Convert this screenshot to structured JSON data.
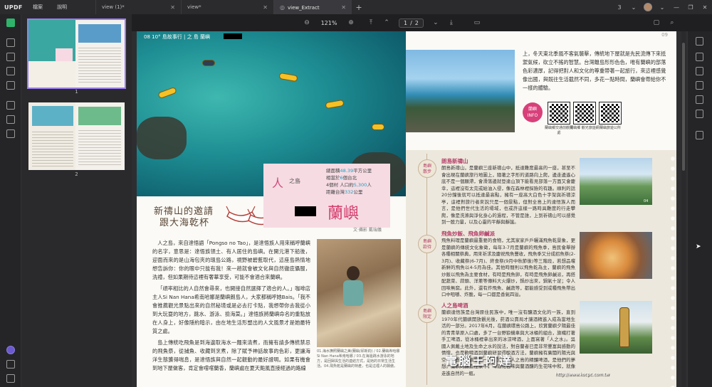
{
  "app": {
    "logo": "UPDF",
    "menu": [
      "檔案",
      "說明"
    ]
  },
  "tabs": [
    {
      "label": "view (1)*",
      "active": false
    },
    {
      "label": "view*",
      "active": false
    },
    {
      "label": "view_Extract",
      "active": true
    }
  ],
  "window": {
    "page_counter": "3"
  },
  "toolbar": {
    "zoom": "121%",
    "current_page": "1",
    "total_pages": "2"
  },
  "thumbnails": [
    {
      "number": "1",
      "selected": true
    },
    {
      "number": "2",
      "selected": false
    }
  ],
  "left_page": {
    "header": "08  10° 島故事行 | 之 島   蘭嶼",
    "headline_line1": "新禱山的邀請",
    "headline_line2": "跟大海乾杯",
    "ren": "人",
    "zhi_dao": "之島",
    "stats": [
      {
        "pre": "總面積",
        "num": "48.39",
        "post": "平方公里"
      },
      {
        "pre": "相當於",
        "num": "6",
        "post": "個台北"
      },
      {
        "pre": "4個村 人口約",
        "num": "5,300",
        "post": "人"
      },
      {
        "pre": "距離台灣",
        "num": "332",
        "post": "公里"
      }
    ],
    "island_title": "蘭嶼",
    "author": "文‧攝影 戴瑞儀",
    "body": [
      "人之島，來自達悟語「Pongso no Tao」，是達悟族人用來稱呼蘭嶼的名字，意思是：達悟族領土、有人居住的島嶼。在開元港下船後，迎面而來的是山海包夾的環島公路，視野被碧藍取代，這座島熱情地想告訴你：你的眼中只能有我！來一趟就會被文化與自然徹底懾服，洗禮，但如果期待這裡有奢華享受，可能不會適合來蘭嶼。",
      "「頑率相比的人自然會尋來，也開接自然選擇了適合的人。」咖啡店主人Si Nan Hana希南哈娜是蘭嶼朗島人，大家都稱呼她Bais。「我不會推薦觀光景點出來的自然秘境或是必去打卡點，我想帶你去我從小到大玩耍的地方，跳水、游泳、撿海菜。」達悟族將蘭嶼命名的重點放在人身上，好像隱約暗示，由在地生活形塑出的人文風景才是她最特質之處。",
      "島上傳統吃飛魚是到海邊取海水一麵來清煮，而擁有請多傳統禁忌的飛魚祭，從捕魚、收藏到烹煮，除了賦予神話故事的色彩，更讓海洋生態獲得喘息，是達悟族與自然一起觀動的最好證明。如果有機會到地下屋做客，肯定會嚐嚐蘭香，蘭嶼處在夏天颱風直接經過的路線"
    ],
    "caption": "01.海水撫照蘭嶼之美(蘭嶼/邱新鈞) / 02.蘭嶼希哈娜Si Nan Hana希南哈娜 / 03.在海邊跳水游泳的地方，是回歸與生活的連結方式，是她的日常生活生活。04.飛魚乾是蘭嶼的特產，也是這裡人的驕傲。"
  },
  "right_page": {
    "page_number": "09",
    "intro": "上，冬天東北季風不客氣襲擊，傳統地下屋就是先民流傳下來抵禦氣候，砍立不搖的智慧。台灣離島形形色色，唯有蘭嶼的部落色彩濃厚，記得把對人和文化的尊重帶著一起旅行，來這裡感覺像出國，與既往生活截然不同，多花一點時間，蘭嶼會帶給你不一樣的體驗。",
    "info_badge_line1": "蘭嶼",
    "info_badge_line2": "INFO",
    "qr_labels": [
      "蘭嶼鄉交通前觀光處",
      "蘭嶼鄉 觀光旅遊網",
      "蘭嶼旅遊公所"
    ],
    "sections": [
      {
        "badge_line1": "島嶼",
        "badge_line2": "散步",
        "title": "朗島新禱山",
        "text": "朗島新禱山，是蘭嶼三座新禱山中，抵達難度最高的一座，甚至不會出現在蘭嶼旅行地圖上，隨著之字形的道路向上爬，邊走邊遙心底不是一個願滯，會滑落邊就登達山頂下能看見部落一方面又會慶幸，這裡沒有太完或給油入侵，像在森林裡探險的有趣。順利的話20分鐘後就可以抵達最高點，擁有一座高大白色十字架與祈禱涼亭，這裡對旅行者來說只是一個景點，但對全島上的達悟族人而言，是他們世代生活的場域，也或許這樣一路時具難度的行走攀爬，像是洗滌與淨化身心的過程，不管是誰，上到祈禱山可以感覺到一股力量，以及心靈的平靜與靜謐。",
        "photo_num": "04"
      },
      {
        "badge_line1": "島嶼",
        "badge_line2": "款待",
        "title": "飛魚炒飯、飛魚卵鹹派",
        "text": "飛魚料理是蘭嶼最重要的食物，尤其家家戶戶曬滿飛魚乾景象，更是蘭嶼的傳統文化象徵，每年3-7月是蘭嶼的飛魚季，島民會舉辦各種相關祭典，用來祈求及慶祝飛魚豐收，飛魚季又分成招魚祭(2-3月)、收藏祭(6-7月)、終食祭(9月中秋節後)等三階段，若想品嚐新鮮的飛魚以4-5月為佳。其他時間則以飛魚乾為主，蘭嶼的飛魚炒飯以飛魚為主要食材，有時是飛魚卵，有時是飛魚卵鹹派，再搭配蔬菜、蒜頭、洋蔥等傳料大火爆炒，鍋炒出來，鍋氣十足；令人回味無窮。此外，還有炸飛魚、鹹蔬等，都能感受到或種飛魚帶出口中咀嚼、炸脆，每一口都是香氣四溢。"
      },
      {
        "badge_line1": "島嶼",
        "badge_line2": "限定",
        "title": "人之島啤酒",
        "text": "蘭嶼達悟族是台灣原住民族中，唯一沒有釀酒文化的一族，直到1970年代蘭嶼開放觀光後，菸酒公賣局才讓酒精進入成為當地生活的一部分。2017年6月，在蘭嶼環島公路上，欣賞蘭嶼夕陽最佳的青青草原入口處，多了一台野狼機車與大冰桶的組合，旗幟打著手工啤酒，從冰桶裡拿出來的冰涼啤酒，上面寫著「人之水」。吳國人佩戴土地及生命之水的說法，對自蘭者已是非常豐富與感動的情懷，也是歡喝酒到蘭嶼研習得酿酒方法，蘭嶼擁有廣闊的陽光與空氣，想為蘭嶼釀第一支屬於這座人之島的精釀啤酒，是他們的夢想。蘭嶼的釀造在家下，啤酒花苞味與蘭酒釀的生花味中和，就像走進自然的一瓶。"
      }
    ]
  },
  "watermark": {
    "text": "電腦王阿達",
    "url": "http://www.kocpc.com.tw"
  }
}
